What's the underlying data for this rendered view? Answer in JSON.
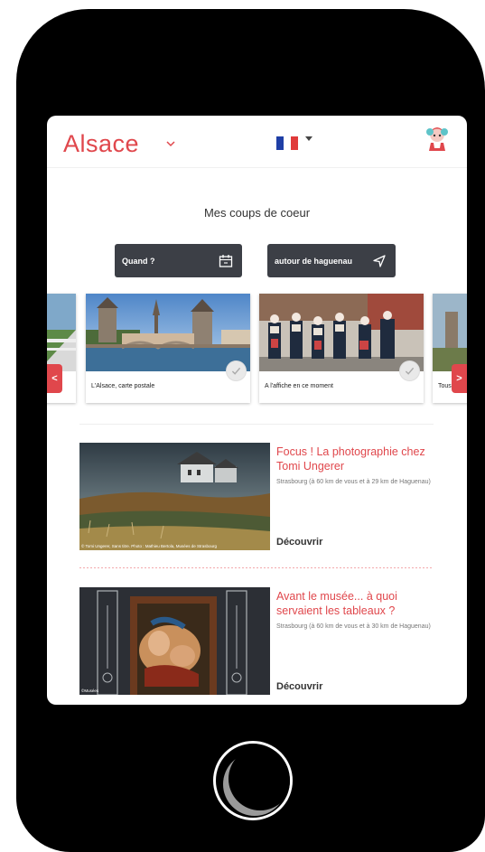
{
  "header": {
    "logo_text": "Alsace",
    "language": "fr"
  },
  "section": {
    "title": "Mes coups de coeur"
  },
  "filters": {
    "when_label": "Quand ?",
    "where_label": "autour de haguenau"
  },
  "carousel": {
    "cards": [
      {
        "caption": "L'Alsace, carte postale"
      },
      {
        "caption": "A l'affiche en ce moment"
      },
      {
        "caption": "Tous l"
      }
    ],
    "prev_label": "<",
    "next_label": ">"
  },
  "articles": [
    {
      "title": "Focus ! La photographie chez Tomi Ungerer",
      "place": "Strasbourg (à 60 km de vous et à 29 km de Haguenau)",
      "cta": "Découvrir",
      "credit": "© Tomi Ungerer, Sans titre. Photo : Mathieu Bertola, Musées de Strasbourg"
    },
    {
      "title": "Avant le musée... à quoi servaient les tableaux ?",
      "place": "Strasbourg (à 60 km de vous et à 30 km de Haguenau)",
      "cta": "Découvrir",
      "credit": "©Musées"
    }
  ],
  "colors": {
    "brand": "#e0474c",
    "button_dark": "#3c3f46"
  }
}
